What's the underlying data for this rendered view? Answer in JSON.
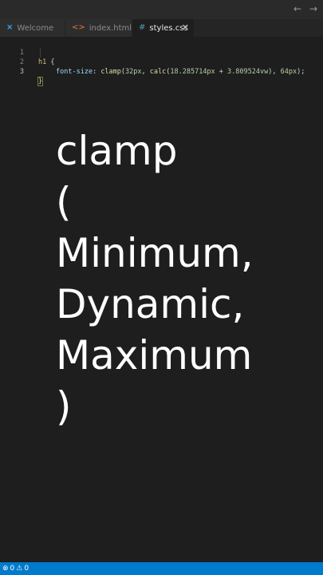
{
  "titlebar": {
    "nav_back_icon": "arrow-left-icon",
    "nav_forward_icon": "arrow-right-icon",
    "nav_back_glyph": "←",
    "nav_forward_glyph": "→"
  },
  "tabs": [
    {
      "label": "Welcome",
      "icon": "vscode-logo-icon",
      "icon_glyph": "⨯",
      "active": false
    },
    {
      "label": "index.html",
      "icon": "html-file-icon",
      "icon_glyph": "<>",
      "active": false
    },
    {
      "label": "styles.css",
      "icon": "css-file-icon",
      "icon_glyph": "#",
      "active": true,
      "close_glyph": "✕"
    }
  ],
  "editor": {
    "line_numbers": [
      "1",
      "2",
      "3"
    ],
    "line1": {
      "selector": "h1",
      "brace": "{"
    },
    "line2": {
      "property": "font-size",
      "colon": ": ",
      "fn_outer": "clamp",
      "paren_open": "(",
      "min": "32px",
      "comma1": ", ",
      "fn_inner": "calc",
      "inner_open": "(",
      "part1": "18.285714px",
      "op": " + ",
      "part2": "3.809524vw",
      "inner_close": ")",
      "comma2": ", ",
      "max": "64px",
      "close": ");"
    },
    "line3": {
      "brace": "}"
    }
  },
  "overlay": {
    "lines": [
      "clamp",
      "(",
      "Minimum,",
      "Dynamic,",
      "Maximum",
      ")"
    ]
  },
  "statusbar": {
    "errors_icon": "error-circle-icon",
    "errors_glyph": "⊗",
    "errors_count": "0",
    "warnings_icon": "warning-triangle-icon",
    "warnings_glyph": "⚠",
    "warnings_count": "0"
  },
  "colors": {
    "statusbar": "#007acc",
    "editor_bg": "#1e1e1e",
    "tab_bg": "#2d2d2d"
  }
}
